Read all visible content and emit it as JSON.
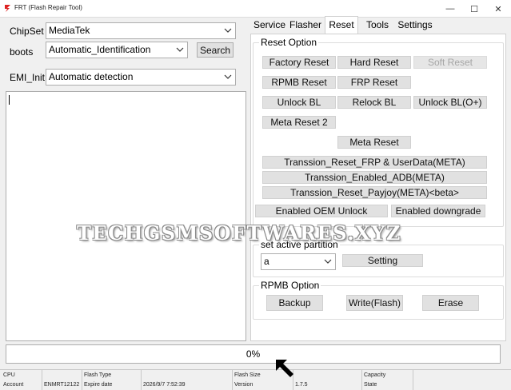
{
  "window": {
    "title": "FRT (Flash Repair Tool)",
    "minimize_glyph": "—",
    "maximize_glyph": "☐",
    "close_glyph": "✕"
  },
  "left": {
    "chipset_label": "ChipSet",
    "chipset_value": "MediaTek",
    "boots_label": "boots",
    "boots_value": "Automatic_Identification",
    "search_label": "Search",
    "emi_label": "EMI_Init",
    "emi_value": "Automatic detection"
  },
  "tabs": [
    {
      "label": "Service"
    },
    {
      "label": "Flasher"
    },
    {
      "label": "Reset",
      "active": true
    },
    {
      "label": "Tools"
    },
    {
      "label": "Settings"
    }
  ],
  "reset_option": {
    "title": "Reset Option",
    "factory_reset": "Factory Reset",
    "hard_reset": "Hard Reset",
    "soft_reset": "Soft Reset",
    "rpmb_reset": "RPMB Reset",
    "frp_reset": "FRP Reset",
    "unlock_bl": "Unlock BL",
    "relock_bl": "Relock BL",
    "unlock_bl_o": "Unlock BL(O+)",
    "meta_reset_2": "Meta Reset 2",
    "meta_reset": "Meta Reset",
    "transsion_frp": "Transsion_Reset_FRP & UserData(META)",
    "transsion_adb": "Transsion_Enabled_ADB(META)",
    "transsion_payjoy": "Transsion_Reset_Payjoy(META)<beta>",
    "enabled_oem_unlock": "Enabled OEM Unlock",
    "enabled_downgrade": "Enabled downgrade"
  },
  "partition": {
    "title": "set active partition",
    "value": "a",
    "setting_label": "Setting"
  },
  "rpmb": {
    "title": "RPMB Option",
    "backup": "Backup",
    "write": "Write(Flash)",
    "erase": "Erase"
  },
  "progress": {
    "text": "0%",
    "fraction": 0
  },
  "status": {
    "cpu_label": "CPU",
    "account_label": "Account",
    "account_value": "ENMRT12122",
    "flash_type_label": "Flash Type",
    "expire_label": "Expire date",
    "expire_value": "2026/9/7 7:52:39",
    "flash_size_label": "Flash Size",
    "version_label": "Version",
    "version_value": "1.7.5",
    "capacity_label": "Capacity",
    "state_label": "State"
  },
  "watermark": "TECHGSMSOFTWARES.XYZ",
  "colors": {
    "accent_progress": "#06b025",
    "button_bg": "#e1e1e1",
    "window_bg": "#f0f0f0"
  },
  "icons": {
    "app": "app-logo-icon",
    "dropdown": "chevron-down-icon",
    "pointer": "arrow-pointer-icon"
  }
}
